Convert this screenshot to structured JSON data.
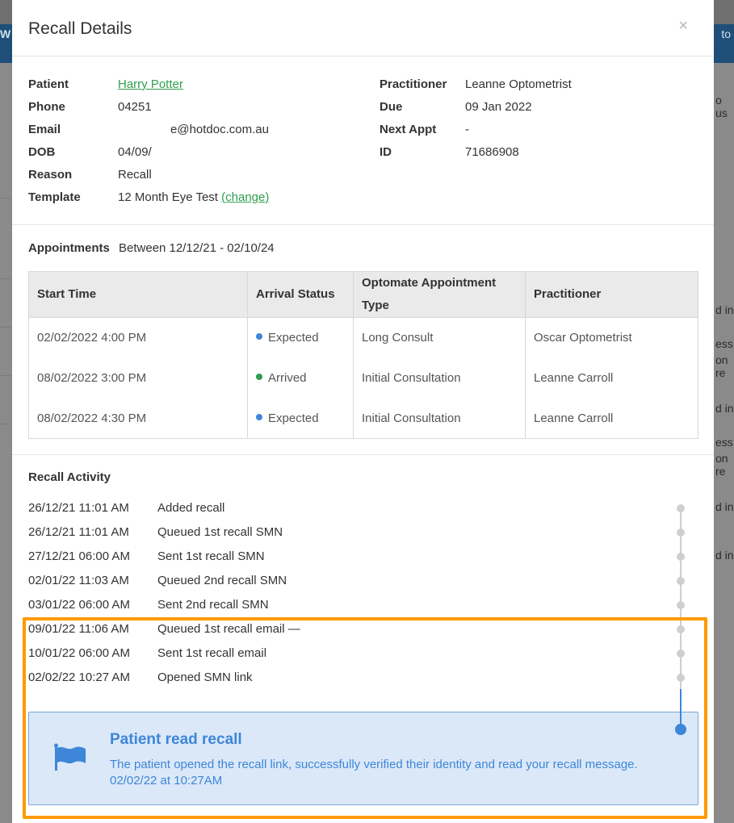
{
  "background": {
    "banner_left": "W",
    "banner_right": "to",
    "right_texts": [
      "o us",
      "d in",
      "ess",
      "on re",
      "d in",
      "ess",
      "on re",
      "d in",
      "d in"
    ]
  },
  "modal": {
    "title": "Recall Details",
    "close_icon": "×"
  },
  "details": {
    "left": [
      {
        "label": "Patient",
        "value": "Harry Potter",
        "is_link": true
      },
      {
        "label": "Phone",
        "value": "04251"
      },
      {
        "label": "Email",
        "value": "e@hotdoc.com.au"
      },
      {
        "label": "DOB",
        "value": "04/09/"
      },
      {
        "label": "Reason",
        "value": "Recall"
      },
      {
        "label": "Template",
        "value": "12 Month Eye Test",
        "link": "(change)"
      }
    ],
    "right": [
      {
        "label": "Practitioner",
        "value": "Leanne Optometrist"
      },
      {
        "label": "Due",
        "value": "09 Jan 2022"
      },
      {
        "label": "Next Appt",
        "value": "-"
      },
      {
        "label": "ID",
        "value": "71686908"
      }
    ]
  },
  "appointments": {
    "label": "Appointments",
    "range": "Between 12/12/21 - 02/10/24",
    "columns": [
      "Start Time",
      "Arrival Status",
      "Optomate Appointment Type",
      "Practitioner"
    ],
    "rows": [
      {
        "start": "02/02/2022 4:00 PM",
        "status": "Expected",
        "status_color": "#3d86d8",
        "type": "Long Consult",
        "practitioner": "Oscar Optometrist"
      },
      {
        "start": "08/02/2022 3:00 PM",
        "status": "Arrived",
        "status_color": "#2e9e4e",
        "type": "Initial Consultation",
        "practitioner": "Leanne Carroll"
      },
      {
        "start": "08/02/2022 4:30 PM",
        "status": "Expected",
        "status_color": "#3d86d8",
        "type": "Initial Consultation",
        "practitioner": "Leanne Carroll"
      }
    ]
  },
  "activity": {
    "title": "Recall Activity",
    "items": [
      {
        "date": "26/12/21  11:01 AM",
        "text": "Added recall"
      },
      {
        "date": "26/12/21  11:01 AM",
        "text": "Queued 1st recall SMN"
      },
      {
        "date": "27/12/21  06:00 AM",
        "text": "Sent 1st recall SMN"
      },
      {
        "date": "02/01/22  11:03 AM",
        "text": "Queued 2nd recall SMN"
      },
      {
        "date": "03/01/22  06:00 AM",
        "text": "Sent 2nd recall SMN"
      },
      {
        "date": "09/01/22  11:06 AM",
        "text": "Queued 1st recall email —"
      },
      {
        "date": "10/01/22  06:00 AM",
        "text": "Sent 1st recall email"
      },
      {
        "date": "02/02/22  10:27 AM",
        "text": "Opened SMN link"
      }
    ],
    "alert": {
      "icon": "flag-icon",
      "title": "Patient read recall",
      "body": "The patient opened the recall link, successfully verified their identity and read your recall message.",
      "timestamp": "02/02/22 at 10:27AM"
    }
  },
  "colors": {
    "accent_green": "#2e9e4e",
    "accent_blue": "#3d86d8",
    "highlight_orange": "#ff9a00"
  }
}
